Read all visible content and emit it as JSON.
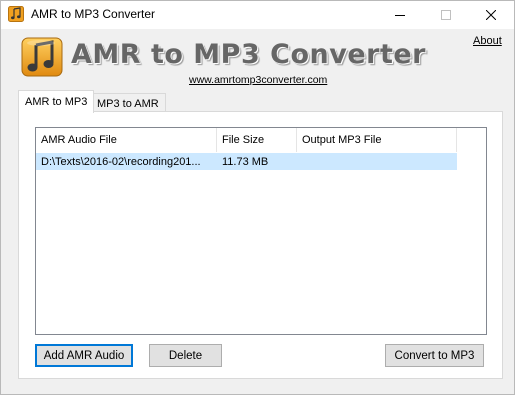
{
  "window": {
    "title": "AMR to MP3 Converter",
    "icons": {
      "app": "music-note-icon",
      "minimize": "minimize-icon",
      "maximize": "maximize-icon",
      "close": "close-icon"
    }
  },
  "header": {
    "app_name": "AMR to MP3 Converter",
    "website": "www.amrtomp3converter.com",
    "about": "About"
  },
  "tabs": [
    {
      "label": "AMR to MP3",
      "active": true
    },
    {
      "label": "MP3 to AMR",
      "active": false
    }
  ],
  "file_list": {
    "columns": [
      "AMR Audio File",
      "File Size",
      "Output MP3 File"
    ],
    "rows": [
      {
        "file": "D:\\Texts\\2016-02\\recording201...",
        "size": "11.73 MB",
        "output": "",
        "selected": true
      }
    ]
  },
  "buttons": {
    "add": "Add AMR Audio",
    "delete": "Delete",
    "convert": "Convert to MP3"
  },
  "colors": {
    "selection": "#cce8ff",
    "focus_border": "#0078d7",
    "logo_orange": "#f0a020"
  }
}
